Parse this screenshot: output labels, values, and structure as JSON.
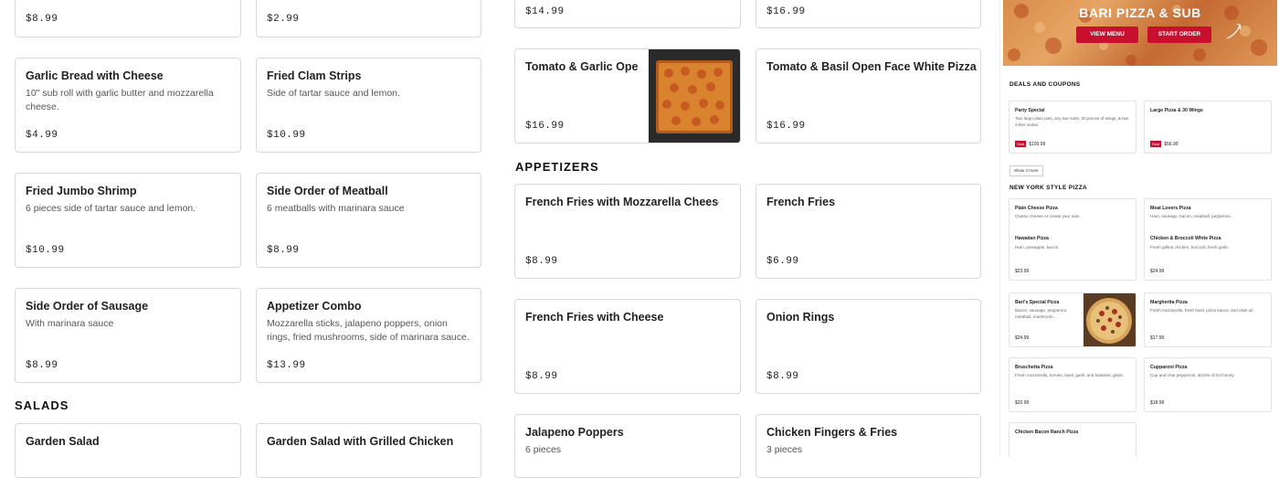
{
  "left_column": {
    "items": [
      {
        "name": "",
        "desc": "",
        "price": "$8.99"
      },
      {
        "name": "",
        "desc": "",
        "price": "$2.99"
      },
      {
        "name": "Garlic Bread with Cheese",
        "desc": "10\" sub roll with garlic butter and mozzarella cheese.",
        "price": "$4.99"
      },
      {
        "name": "Fried Clam Strips",
        "desc": "Side of tartar sauce and lemon.",
        "price": "$10.99"
      },
      {
        "name": "Fried Jumbo Shrimp",
        "desc": "6 pieces side of tartar sauce and lemon.",
        "price": "$10.99"
      },
      {
        "name": "Side Order of Meatball",
        "desc": "6 meatballs with marinara sauce",
        "price": "$8.99"
      },
      {
        "name": "Side Order of Sausage",
        "desc": "With marinara sauce",
        "price": "$8.99"
      },
      {
        "name": "Appetizer Combo",
        "desc": "Mozzarella sticks, jalapeno poppers, onion rings, fried mushrooms, side of marinara sauce.",
        "price": "$13.99"
      },
      {
        "name": "Garden Salad",
        "desc": "",
        "price": ""
      },
      {
        "name": "Garden Salad with Grilled Chicken",
        "desc": "",
        "price": ""
      }
    ],
    "salads_heading": "SALADS"
  },
  "middle_column": {
    "items": [
      {
        "name": "",
        "desc": "",
        "price": "$14.99"
      },
      {
        "name": "",
        "desc": "",
        "price": "$16.99"
      },
      {
        "name": "Tomato & Garlic Open Face White Pizza",
        "desc": "",
        "price": "$16.99"
      },
      {
        "name": "Tomato & Basil Open Face White Pizza",
        "desc": "",
        "price": "$16.99"
      },
      {
        "name": "French Fries with Mozzarella Cheese and Gravy",
        "desc": "",
        "price": "$8.99"
      },
      {
        "name": "French Fries",
        "desc": "",
        "price": "$6.99"
      },
      {
        "name": "French Fries with Cheese",
        "desc": "",
        "price": "$8.99"
      },
      {
        "name": "Onion Rings",
        "desc": "",
        "price": "$8.99"
      },
      {
        "name": "Jalapeno Poppers",
        "desc": "6 pieces",
        "price": ""
      },
      {
        "name": "Chicken Fingers & Fries",
        "desc": "3 pieces",
        "price": ""
      }
    ],
    "appetizers_heading": "APPETIZERS"
  },
  "preview": {
    "hero_title": "BARI PIZZA & SUB",
    "view_menu": "VIEW MENU",
    "start_order": "START ORDER",
    "deals_heading": "DEALS AND COUPONS",
    "deals": [
      {
        "name": "Party Special",
        "desc": "Two large plain pies, any two subs, 30 pieces of wings, & two 2-liter sodas.",
        "tag": "Deal",
        "price": "$100.99"
      },
      {
        "name": "Large Pizza & 30 Wings",
        "desc": "",
        "tag": "Deal",
        "price": "$56.99"
      }
    ],
    "show_more": "Show 4 more",
    "ny_heading": "NEW YORK STYLE PIZZA",
    "pizzas": [
      {
        "name": "Plain Cheese Pizza",
        "desc": "Classic cheese or create your own.",
        "price": ""
      },
      {
        "name": "Meat Lovers Pizza",
        "desc": "Ham, sausage, bacon, meatball, pepperoni.",
        "price": ""
      },
      {
        "name": "Hawaiian Pizza",
        "desc": "Ham, pineapple, bacon.",
        "price": "$23.99"
      },
      {
        "name": "Chicken & Broccoli White Pizza",
        "desc": "Fresh grilled chicken, broccoli, fresh garlic.",
        "price": "$24.99"
      },
      {
        "name": "Bari's Special Pizza",
        "desc": "Bacon, sausage, pepperoni, meatball, mushroom,...",
        "price": "$24.99"
      },
      {
        "name": "Margherita Pizza",
        "desc": "Fresh mozzarella, fresh basil, pizza sauce, and olive oil.",
        "price": "$17.99"
      },
      {
        "name": "Bruschetta Pizza",
        "desc": "Fresh mozzarella, tomato, basil, garlic and balsamic glaze.",
        "price": "$20.99"
      },
      {
        "name": "Cupparoni Pizza",
        "desc": "Cup and char pepperoni, drizzle of hot honey",
        "price": "$18.99"
      },
      {
        "name": "Chicken Bacon Ranch Pizza",
        "desc": "",
        "price": ""
      }
    ]
  }
}
